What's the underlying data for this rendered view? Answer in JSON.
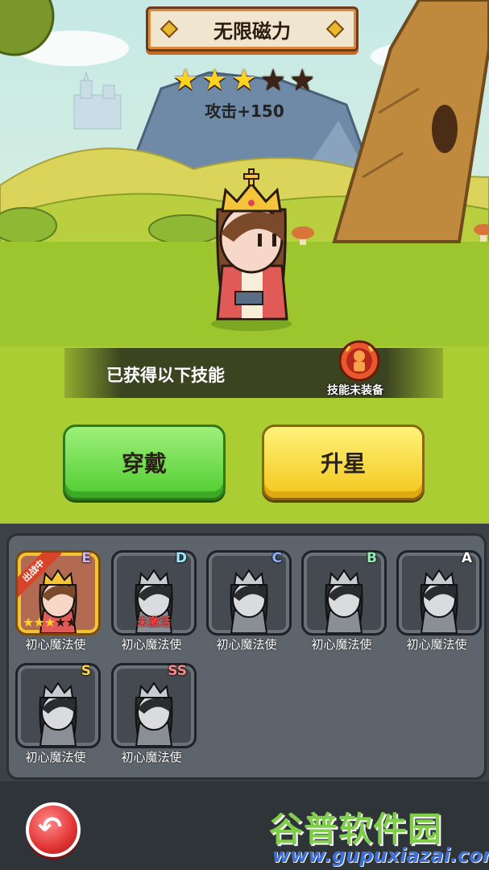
{
  "hero": {
    "title": "无限磁力",
    "stars_total": 5,
    "stars_filled": 3,
    "attack_label": "攻击+150"
  },
  "skill_banner": {
    "label": "已获得以下技能",
    "status": "技能未装备",
    "icon": "red-skill-icon"
  },
  "buttons": {
    "equip_label": "穿戴",
    "upgrade_label": "升星"
  },
  "roster": [
    {
      "name": "初心魔法使",
      "rank": "E",
      "rank_color": "#c9b6ff",
      "selected": true,
      "status": "出战中",
      "stars_filled": 3,
      "stars_total": 5
    },
    {
      "name": "初心魔法使",
      "rank": "D",
      "rank_color": "#9fe8ff",
      "selected": false,
      "status": "未激活"
    },
    {
      "name": "初心魔法使",
      "rank": "C",
      "rank_color": "#8fb4ff",
      "selected": false
    },
    {
      "name": "初心魔法使",
      "rank": "B",
      "rank_color": "#8ff0b0",
      "selected": false
    },
    {
      "name": "初心魔法使",
      "rank": "A",
      "rank_color": "#ffffff",
      "selected": false
    },
    {
      "name": "初心魔法使",
      "rank": "S",
      "rank_color": "#ffd54a",
      "selected": false
    },
    {
      "name": "初心魔法使",
      "rank": "SS",
      "rank_color": "#ff8a8a",
      "selected": false
    }
  ],
  "back_button": {
    "icon": "undo-arrow-icon"
  },
  "watermark": {
    "title": "谷普软件园",
    "url": "www.gupuxiazai.com"
  },
  "colors": {
    "equip_green": "#4fcc2f",
    "upgrade_yellow": "#f2c71b",
    "star_gold": "#ffd21f",
    "back_red": "#e13434"
  }
}
